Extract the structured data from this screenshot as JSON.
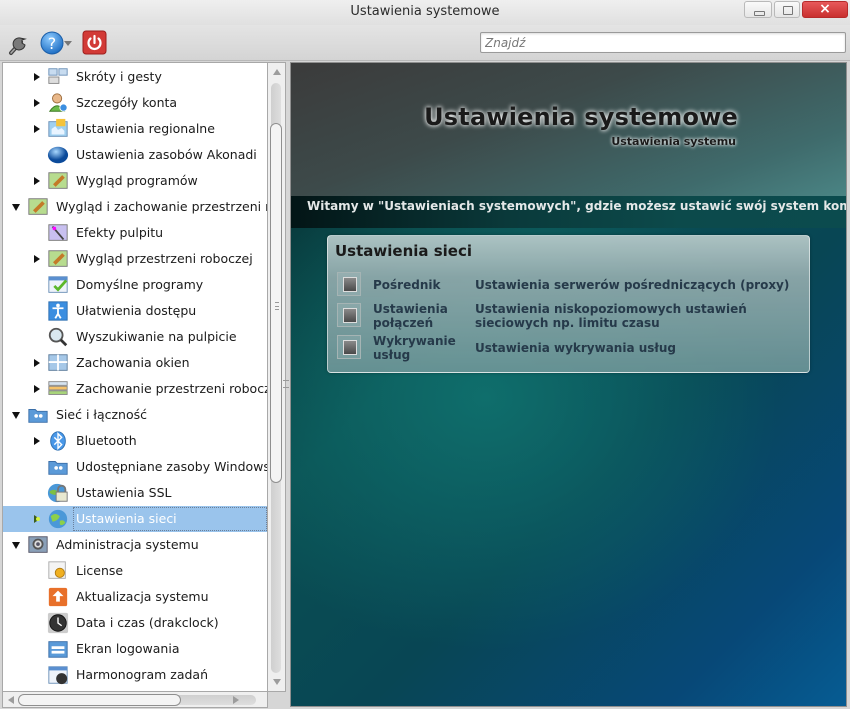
{
  "window": {
    "title": "Ustawienia systemowe",
    "controls": {
      "minimize": "minimize",
      "maximize": "maximize",
      "close": "close"
    }
  },
  "toolbar": {
    "icons": [
      "wrench-icon",
      "help-icon",
      "quit-icon"
    ],
    "search_placeholder": "Znajdź",
    "search_value": ""
  },
  "sidebar": {
    "items": [
      {
        "label": "Skróty i gesty",
        "level": 1,
        "expander": "collapsed",
        "icon": "keyboard-shortcuts-icon"
      },
      {
        "label": "Szczegóły konta",
        "level": 1,
        "expander": "collapsed",
        "icon": "user-account-icon"
      },
      {
        "label": "Ustawienia regionalne",
        "level": 1,
        "expander": "collapsed",
        "icon": "regional-map-icon"
      },
      {
        "label": "Ustawienia zasobów Akonadi",
        "level": 1,
        "expander": "none",
        "icon": "akonadi-sphere-icon"
      },
      {
        "label": "Wygląd programów",
        "level": 1,
        "expander": "collapsed",
        "icon": "appearance-brush-icon"
      },
      {
        "label": "Wygląd i zachowanie przestrzeni roboczej",
        "level": 0,
        "expander": "expanded",
        "icon": "workspace-brush-icon"
      },
      {
        "label": "Efekty pulpitu",
        "level": 1,
        "expander": "none",
        "icon": "desktop-effects-icon"
      },
      {
        "label": "Wygląd przestrzeni roboczej",
        "level": 1,
        "expander": "collapsed",
        "icon": "workspace-appearance-icon"
      },
      {
        "label": "Domyślne programy",
        "level": 1,
        "expander": "none",
        "icon": "default-apps-check-icon"
      },
      {
        "label": "Ułatwienia dostępu",
        "level": 1,
        "expander": "none",
        "icon": "accessibility-icon"
      },
      {
        "label": "Wyszukiwanie na pulpicie",
        "level": 1,
        "expander": "none",
        "icon": "desktop-search-magnifier-icon"
      },
      {
        "label": "Zachowania okien",
        "level": 1,
        "expander": "collapsed",
        "icon": "window-behavior-icon"
      },
      {
        "label": "Zachowanie przestrzeni roboczej",
        "level": 1,
        "expander": "collapsed",
        "icon": "workspace-layers-icon"
      },
      {
        "label": "Sieć i łączność",
        "level": 0,
        "expander": "expanded",
        "icon": "network-folder-icon"
      },
      {
        "label": "Bluetooth",
        "level": 1,
        "expander": "collapsed",
        "icon": "bluetooth-icon"
      },
      {
        "label": "Udostępniane zasoby Windows",
        "level": 1,
        "expander": "none",
        "icon": "windows-shares-icon"
      },
      {
        "label": "Ustawienia SSL",
        "level": 1,
        "expander": "none",
        "icon": "ssl-lock-icon"
      },
      {
        "label": "Ustawienia sieci",
        "level": 1,
        "expander": "collapsed",
        "icon": "network-globe-icon",
        "selected": true
      },
      {
        "label": "Administracja systemu",
        "level": 0,
        "expander": "expanded",
        "icon": "system-admin-gear-icon"
      },
      {
        "label": "License",
        "level": 1,
        "expander": "none",
        "icon": "license-certificate-icon"
      },
      {
        "label": "Aktualizacja systemu",
        "level": 1,
        "expander": "none",
        "icon": "system-update-arrow-icon"
      },
      {
        "label": "Data i czas (drakclock)",
        "level": 1,
        "expander": "none",
        "icon": "clock-icon"
      },
      {
        "label": "Ekran logowania",
        "level": 1,
        "expander": "none",
        "icon": "login-screen-icon"
      },
      {
        "label": "Harmonogram zadań",
        "level": 1,
        "expander": "none",
        "icon": "task-scheduler-icon"
      }
    ]
  },
  "main": {
    "title": "Ustawienia systemowe",
    "subtitle": "Ustawienia systemu",
    "welcome": "Witamy w \"Ustawieniach systemowych\", gdzie możesz ustawić swój system komputerowy.",
    "card": {
      "title": "Ustawienia sieci",
      "items": [
        {
          "name": "Pośrednik",
          "description": "Ustawienia serwerów pośredniczących (proxy)"
        },
        {
          "name": "Ustawienia połączeń",
          "description": "Ustawienia niskopoziomowych ustawień sieciowych np. limitu czasu"
        },
        {
          "name": "Wykrywanie usług",
          "description": "Ustawienia wykrywania usług"
        }
      ]
    }
  },
  "colors": {
    "selection": "#9ac4ec",
    "close_button": "#d9423f",
    "quit_button": "#d23a36",
    "help_blue": "#2f86d6"
  }
}
